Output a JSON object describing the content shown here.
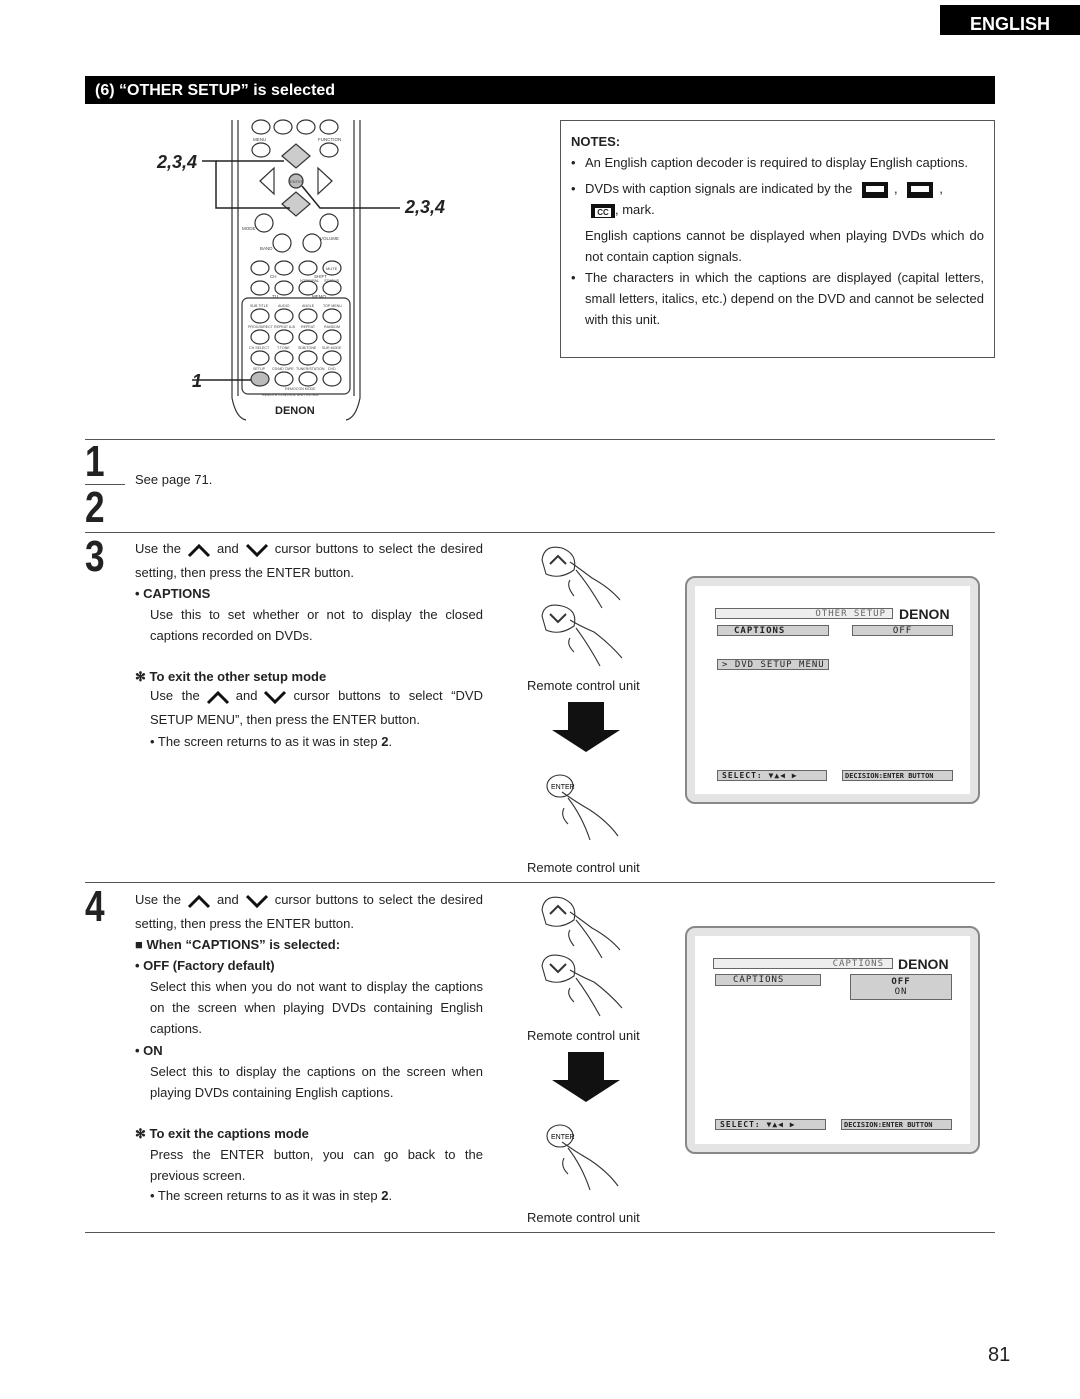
{
  "language_tab": "ENGLISH",
  "header": "(6) “OTHER SETUP” is selected",
  "remote": {
    "labels": {
      "menu": "MENU",
      "function": "FUNCTION",
      "enter": "ENTER",
      "mode": "MODE",
      "volume": "VOLUME",
      "band": "BAND",
      "ch": "CH",
      "shift": "SHIFT",
      "mute": "MUTE",
      "ntsc": "NTSC/PAL",
      "status": "STATUS",
      "tu": "TU",
      "memo": "MEMO",
      "subtitle": "SUB TITLE",
      "audio": "AUDIO",
      "angle": "ANGLE",
      "topmenu": "TOP MENU",
      "prog": "PROG/DIRECT",
      "repeatab": "REPEAT A-B",
      "repeat": "REPEAT",
      "random": "RANDOM",
      "chselect": "CH.SELECT",
      "ttone": "T.TONE",
      "sdbtone": "SDB/TONE",
      "surmode": "SUR.MODE",
      "setup": "SETUP",
      "cdtape": "CD/MD TAPE",
      "tuner": "TUNER/STATION",
      "dvd": "DVD",
      "remocon": "REMOCON MODE",
      "unit": "REMOTE CONTROL UNIT RC-902",
      "brand": "DENON"
    },
    "callout_234_left": "2,3,4",
    "callout_234_right": "2,3,4",
    "callout_1": "1"
  },
  "notes": {
    "title": "NOTES:",
    "items": [
      "An English caption decoder is required to display English captions.",
      "DVDs with caption signals are indicated by the",
      ", mark.",
      "English captions cannot be displayed when playing DVDs which do not contain caption signals.",
      "The characters in which the captions are displayed (capital letters, small letters, italics, etc.) depend on the DVD and cannot be selected with this unit."
    ],
    "cc_label": "CC"
  },
  "steps": {
    "s1": "1",
    "s2": "2",
    "s12_text": "See page 71.",
    "s3": {
      "num": "3",
      "use": "Use the",
      "and": "and",
      "cursor": "cursor buttons to select the desired setting, then press the ENTER button.",
      "captions_title": "• CAPTIONS",
      "captions_desc": "Use this to set whether or not to display the closed captions recorded on DVDs.",
      "exit_title": "✻ To exit the other setup mode",
      "exit_use": "Use the",
      "exit_and": "and",
      "exit_rest": "cursor buttons to select “DVD SETUP MENU”, then press the ENTER button.",
      "returns": "• The screen returns to as it was in step",
      "returns_step": "2",
      "period": "."
    },
    "s4": {
      "num": "4",
      "use": "Use the",
      "and": "and",
      "cursor": "cursor buttons to select the desired setting, then press the ENTER button.",
      "when_title": "■ When “CAPTIONS” is selected:",
      "off_title": "• OFF (Factory default)",
      "off_desc": "Select this when you do not want to display the captions on the screen when playing DVDs containing English captions.",
      "on_title": "• ON",
      "on_desc": "Select this to display the captions on the screen when playing DVDs containing English captions.",
      "exit_title": "✻ To exit the captions mode",
      "exit_desc": "Press the ENTER button, you can go back to the previous screen.",
      "returns": "• The screen returns to as it was in step",
      "returns_step": "2",
      "period": "."
    }
  },
  "illustrations": {
    "remote_control_unit": "Remote control unit",
    "enter": "ENTER"
  },
  "screen1": {
    "title": "OTHER SETUP",
    "brand": "DENON",
    "item": "CAPTIONS",
    "value": "OFF",
    "menu": "> DVD SETUP MENU",
    "select": "SELECT:  ▼▲◀ ▶",
    "decision": "DECISION:ENTER BUTTON"
  },
  "screen2": {
    "title": "CAPTIONS",
    "brand": "DENON",
    "item": "CAPTIONS",
    "opt1": "OFF",
    "opt2": "ON",
    "select": "SELECT:  ▼▲◀ ▶",
    "decision": "DECISION:ENTER BUTTON"
  },
  "page_number": "81"
}
